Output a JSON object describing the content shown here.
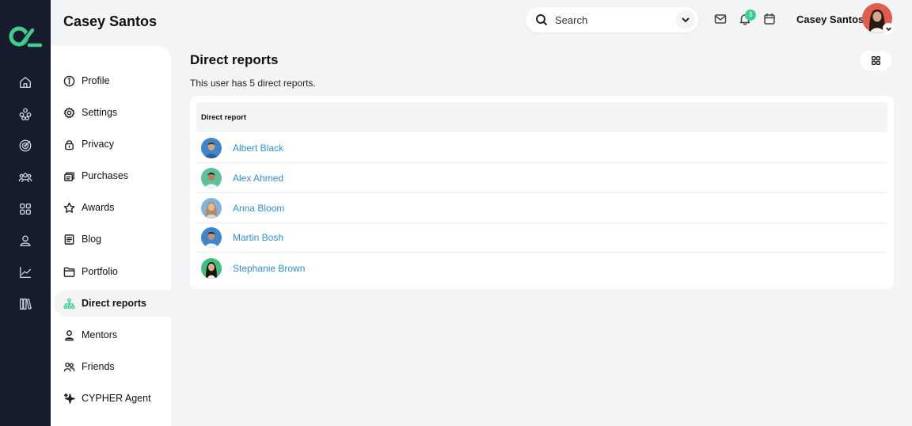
{
  "header": {
    "user_title": "Casey Santos",
    "search_placeholder": "Search",
    "notification_count": "3",
    "profile_name": "Casey Santos"
  },
  "rail": {
    "icons": [
      "home-icon",
      "network-icon",
      "target-icon",
      "team-icon",
      "apps-icon",
      "user-icon",
      "chart-icon",
      "library-icon"
    ]
  },
  "subnav": {
    "items": [
      {
        "label": "Profile",
        "icon": "info-icon"
      },
      {
        "label": "Settings",
        "icon": "gear-icon"
      },
      {
        "label": "Privacy",
        "icon": "lock-icon"
      },
      {
        "label": "Purchases",
        "icon": "purchases-icon"
      },
      {
        "label": "Awards",
        "icon": "star-icon"
      },
      {
        "label": "Blog",
        "icon": "blog-icon"
      },
      {
        "label": "Portfolio",
        "icon": "folder-icon"
      },
      {
        "label": "Direct reports",
        "icon": "org-chart-icon",
        "active": true
      },
      {
        "label": "Mentors",
        "icon": "mentor-icon"
      },
      {
        "label": "Friends",
        "icon": "friends-icon"
      },
      {
        "label": "CYPHER Agent",
        "icon": "sparkle-icon"
      }
    ]
  },
  "main": {
    "title": "Direct reports",
    "subtitle": "This user has 5 direct reports.",
    "table": {
      "header": "Direct report",
      "rows": [
        {
          "name": "Albert Black"
        },
        {
          "name": "Alex Ahmed"
        },
        {
          "name": "Anna Bloom"
        },
        {
          "name": "Martin Bosh"
        },
        {
          "name": "Stephanie Brown"
        }
      ]
    }
  },
  "colors": {
    "rail": "#161c2c",
    "accent": "#3ecf8e",
    "link": "#2f8fd8",
    "background": "#f3f4f6"
  }
}
